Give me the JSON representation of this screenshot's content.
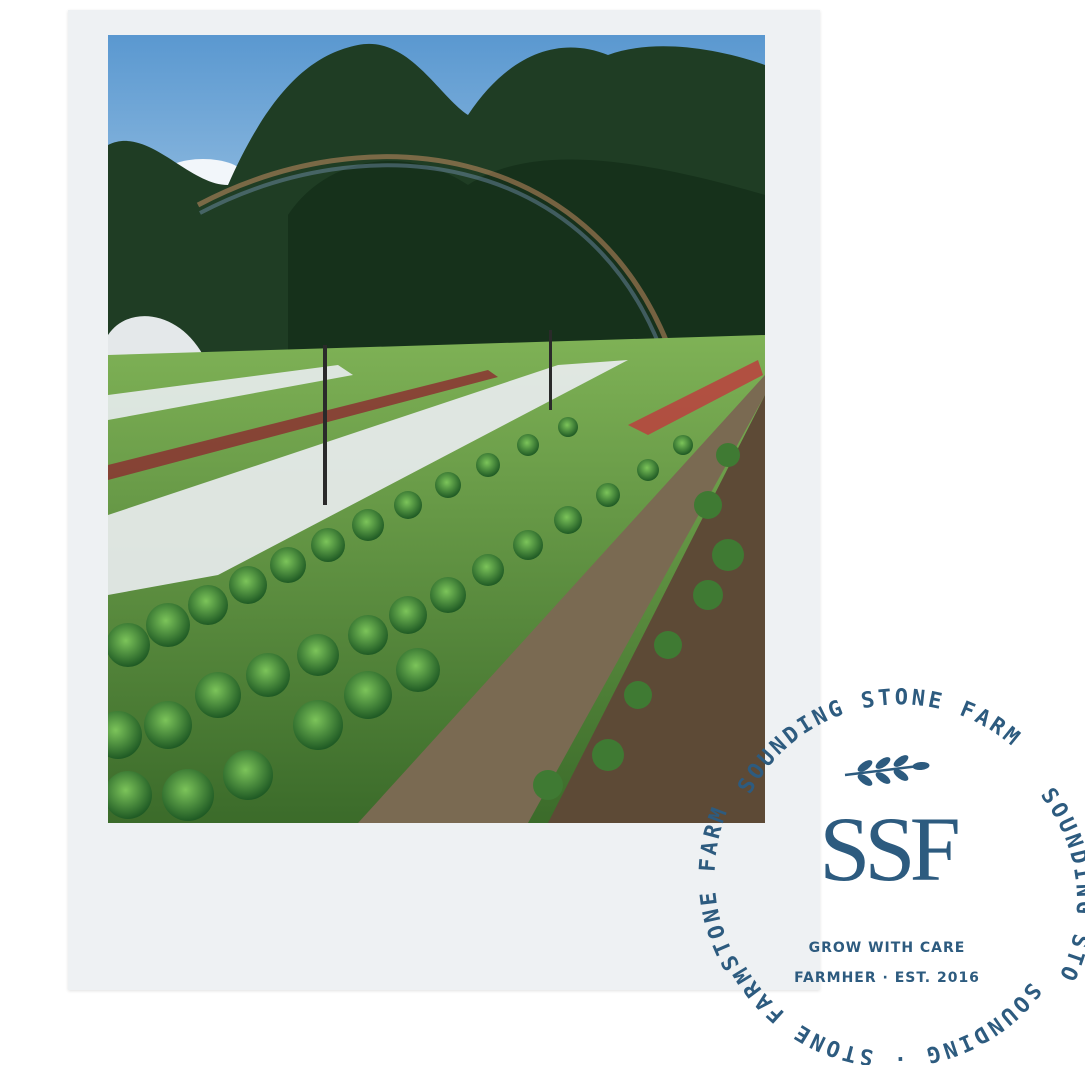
{
  "badge": {
    "ring_top": "SOUNDING STONE FARM",
    "ring_right": "SOUNDING STONE FARM",
    "ring_bottom": "SOUNDING · STONE FARM",
    "ring_left": "STONE FARM",
    "monogram": "SSF",
    "tagline": "GROW WITH CARE",
    "est_line": "FARMHER · EST. 2016",
    "leaf_icon": "leaf-sprig-icon",
    "color": "#2d5b7f"
  },
  "photo": {
    "subject": "farm-field-rows",
    "colors": {
      "sky": "#6fa8d8",
      "trees": "#1d3a22",
      "field": "#4f8a3a",
      "path": "#7a6a52"
    }
  }
}
